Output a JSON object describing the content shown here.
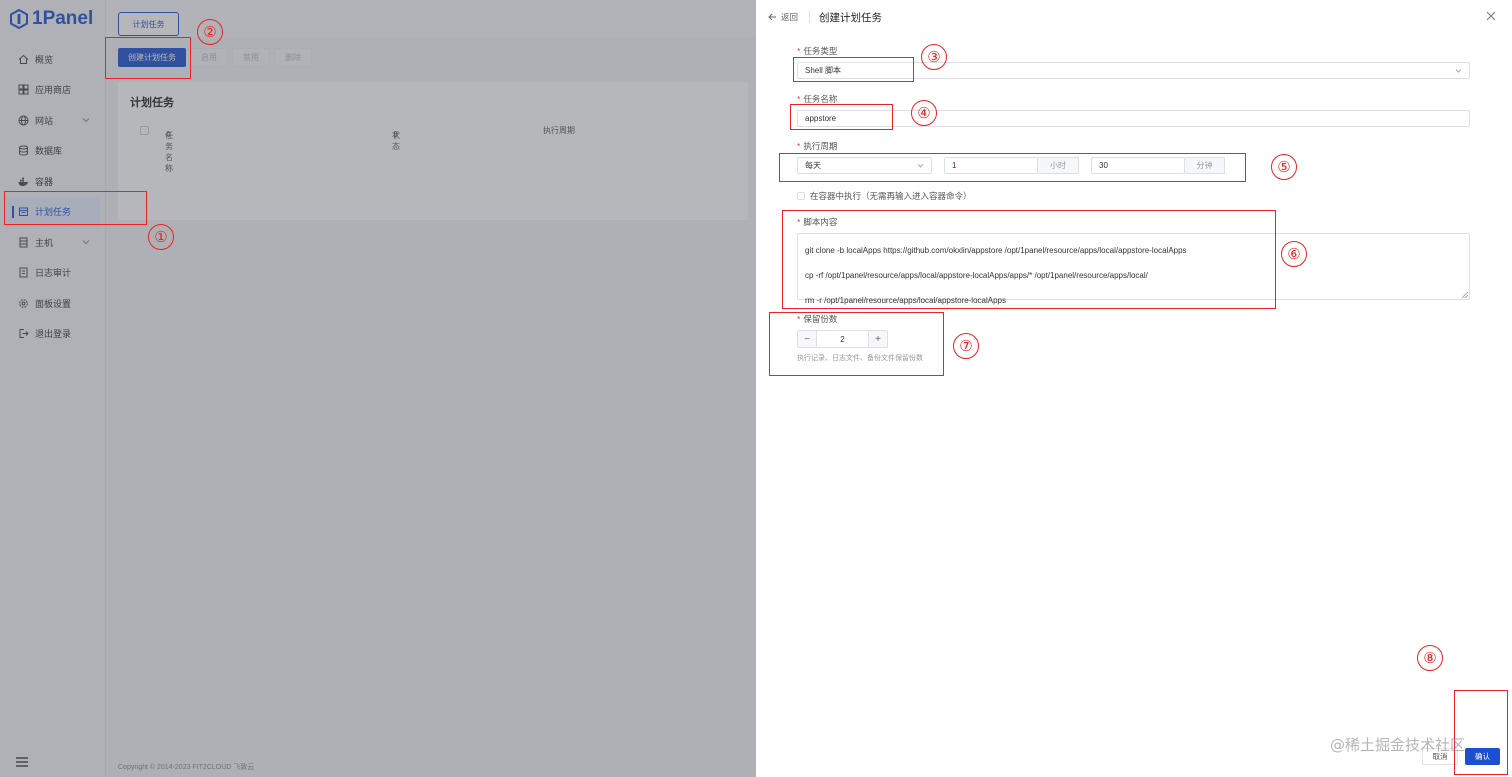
{
  "app": {
    "logo_text": "1Panel",
    "sidebar": {
      "items": [
        {
          "label": "概览",
          "icon": "home-icon"
        },
        {
          "label": "应用商店",
          "icon": "grid-icon"
        },
        {
          "label": "网站",
          "icon": "globe-icon",
          "has_children": true
        },
        {
          "label": "数据库",
          "icon": "database-icon"
        },
        {
          "label": "容器",
          "icon": "docker-icon"
        },
        {
          "label": "计划任务",
          "icon": "calendar-icon",
          "active": true
        },
        {
          "label": "主机",
          "icon": "server-icon",
          "has_children": true
        },
        {
          "label": "日志审计",
          "icon": "log-icon"
        },
        {
          "label": "面板设置",
          "icon": "settings-icon"
        },
        {
          "label": "退出登录",
          "icon": "logout-icon"
        }
      ]
    },
    "topbar": {
      "tab_label": "计划任务"
    },
    "toolbar": {
      "create_label": "创建计划任务",
      "enable_label": "启用",
      "disable_label": "禁用",
      "delete_label": "删除"
    },
    "table": {
      "title": "计划任务",
      "columns": [
        "任务名称",
        "状态",
        "执行周期"
      ]
    },
    "footer": "Copyright © 2014-2023 FIT2CLOUD 飞致云"
  },
  "drawer": {
    "back_label": "返回",
    "title": "创建计划任务",
    "fields": {
      "task_type": {
        "label": "任务类型",
        "value": "Shell 脚本"
      },
      "task_name": {
        "label": "任务名称",
        "value": "appstore"
      },
      "cycle": {
        "label": "执行周期",
        "period": "每天",
        "hour": "1",
        "hour_unit": "小时",
        "minute": "30",
        "minute_unit": "分钟"
      },
      "in_container": {
        "label": "在容器中执行（无需再输入进入容器命令）"
      },
      "script": {
        "label": "脚本内容",
        "lines": [
          "git clone -b localApps https://github.com/okxlin/appstore /opt/1panel/resource/apps/local/appstore-localApps",
          "cp -rf /opt/1panel/resource/apps/local/appstore-localApps/apps/* /opt/1panel/resource/apps/local/",
          "rm -r /opt/1panel/resource/apps/local/appstore-localApps"
        ]
      },
      "retain": {
        "label": "保留份数",
        "value": "2",
        "hint": "执行记录、日志文件、备份文件保留份数"
      }
    },
    "cancel_label": "取消",
    "confirm_label": "确认"
  },
  "annotations": [
    "①",
    "②",
    "③",
    "④",
    "⑤",
    "⑥",
    "⑦",
    "⑧"
  ],
  "watermark": "@稀土掘金技术社区",
  "colors": {
    "accent": "#1d4fd1",
    "annotation": "#e22222"
  }
}
